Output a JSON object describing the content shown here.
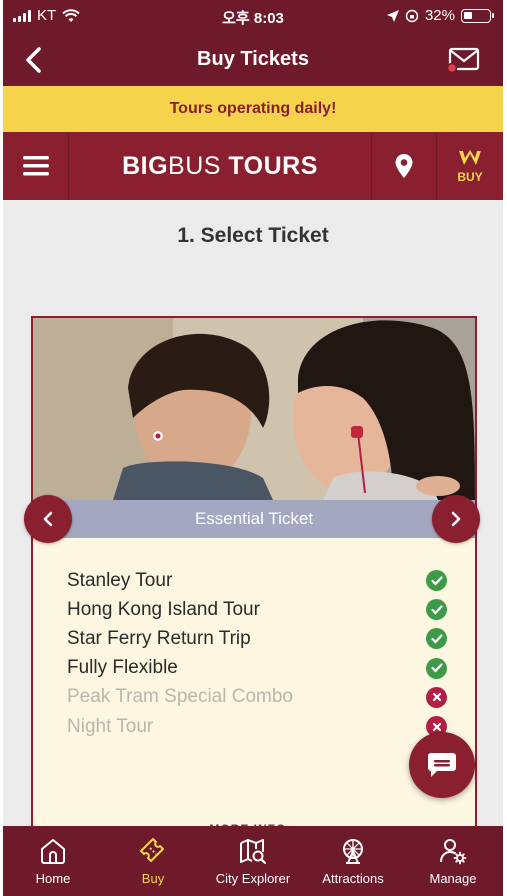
{
  "status_bar": {
    "carrier": "KT",
    "time": "오후 8:03",
    "battery": "32%"
  },
  "header": {
    "title": "Buy Tickets"
  },
  "banner": {
    "text": "Tours operating daily!"
  },
  "brand": {
    "bold_left": "BIG",
    "thin": "BUS",
    "bold_right": " TOURS",
    "buy_label": "BUY"
  },
  "page": {
    "section_title": "1. Select Ticket"
  },
  "ticket": {
    "name": "Essential Ticket",
    "features": [
      {
        "label": "Stanley Tour",
        "included": true
      },
      {
        "label": "Hong Kong Island Tour",
        "included": true
      },
      {
        "label": "Star Ferry Return Trip",
        "included": true
      },
      {
        "label": "Fully Flexible",
        "included": true
      },
      {
        "label": "Peak Tram Special Combo",
        "included": false
      },
      {
        "label": "Night Tour",
        "included": false
      }
    ],
    "more_info": "MORE INFO >"
  },
  "tabs": [
    {
      "label": "Home",
      "icon": "home-icon",
      "active": false
    },
    {
      "label": "Buy",
      "icon": "ticket-icon",
      "active": true
    },
    {
      "label": "City Explorer",
      "icon": "map-search-icon",
      "active": false
    },
    {
      "label": "Attractions",
      "icon": "ferris-wheel-icon",
      "active": false
    },
    {
      "label": "Manage",
      "icon": "user-gear-icon",
      "active": false
    }
  ],
  "colors": {
    "primary": "#8a1f30",
    "header": "#6f1a2b",
    "accent": "#f5d34b",
    "check": "#3e9a48",
    "cross": "#b01f45"
  }
}
